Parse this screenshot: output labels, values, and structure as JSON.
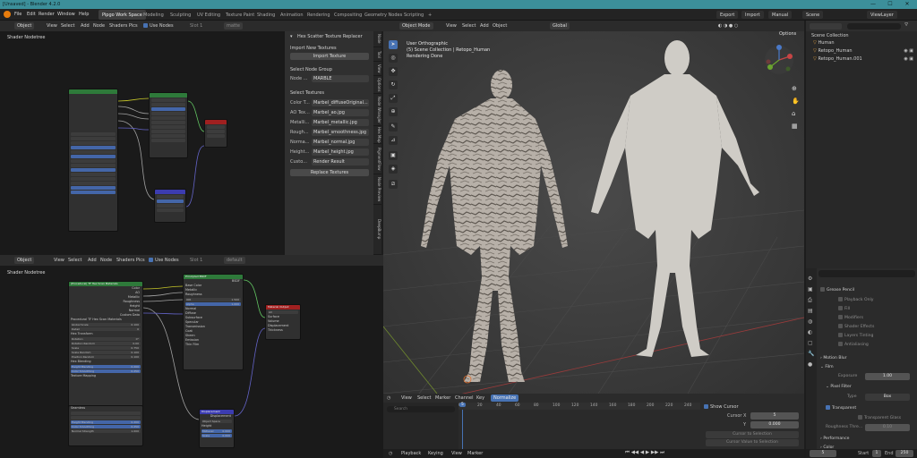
{
  "window": {
    "title": "[Unsaved] - Blender 4.2.0",
    "controls": [
      "—",
      "☐",
      "✕"
    ]
  },
  "menu": [
    "File",
    "Edit",
    "Render",
    "Window",
    "Help"
  ],
  "workspaces": [
    "Pipgo Work Space",
    "Modeling",
    "Sculpting",
    "UV Editing",
    "Texture Paint",
    "Shading",
    "Animation",
    "Rendering",
    "Compositing",
    "Geometry Nodes",
    "Scripting"
  ],
  "topright": {
    "export": "Export",
    "import": "Import",
    "manual": "Manual",
    "scene": "Scene",
    "viewlayer": "ViewLayer"
  },
  "node_editor_top": {
    "header": {
      "mode": "Object",
      "items": [
        "View",
        "Select",
        "Add",
        "Node",
        "Shaders Pics"
      ],
      "use_nodes": "Use Nodes",
      "slot": "Slot 1",
      "material": "matte"
    },
    "title": "Shader Nodetree"
  },
  "node_editor_bottom": {
    "header": {
      "mode": "Object",
      "items": [
        "View",
        "Select",
        "Add",
        "Node",
        "Shaders Pics"
      ],
      "use_nodes": "Use Nodes",
      "slot": "Slot 1",
      "material": "default"
    },
    "title": "Shader Nodetree",
    "nodes": {
      "hex_group": {
        "title": "(Procedural) TF Hex Scan Materials",
        "outputs": [
          "Color",
          "AO",
          "Metallic",
          "Roughness",
          "Height",
          "Normal",
          "Custom Data"
        ],
        "inner_title": "Procedural TF Hex Scan Materials",
        "fields": [
          [
            "Global Scale",
            "0.100"
          ],
          [
            "Detail",
            "0"
          ],
          [
            "Hex Transform",
            ""
          ],
          [
            "Rotation",
            "0°"
          ],
          [
            "Rotation Random",
            "0.00"
          ],
          [
            "Scale",
            "0.750"
          ],
          [
            "Scale Random",
            "0.100"
          ],
          [
            "Position Random",
            "0.100"
          ]
        ],
        "blending": "Hex Blending",
        "blend_fields": [
          [
            "Height Blending",
            "0.200"
          ],
          [
            "Color Smoothing",
            "0.250"
          ]
        ],
        "mapping": "Texture Mapping",
        "section2": "Seamless",
        "bottom_fields": [
          [
            "Height Blending",
            "0.200"
          ],
          [
            "Color Smoothing",
            "0.250"
          ],
          [
            "Normal Strength",
            "1.000"
          ]
        ]
      },
      "principled": {
        "title": "Principled BSDF",
        "out": "BSDF",
        "rows": [
          "Base Color",
          "Metallic",
          "Roughness",
          "IOR",
          "Alpha",
          "Normal",
          "Diffuse",
          "Subsurface",
          "Specular",
          "Transmission",
          "Coat",
          "Sheen",
          "Emission",
          "Thin Film"
        ],
        "vals": {
          "IOR": "1.500",
          "Alpha": "1.000"
        }
      },
      "output": {
        "title": "Material Output",
        "sel": "All",
        "rows": [
          "Surface",
          "Volume",
          "Displacement",
          "Thickness"
        ]
      },
      "displacement": {
        "title": "Displacement",
        "out": "Displacement",
        "rows": [
          "Object Space",
          "Height",
          "Midlevel",
          "Scale",
          "Normal"
        ],
        "vals": {
          "Midlevel": "0.000",
          "Scale": "0.000"
        }
      }
    }
  },
  "npanel": {
    "title": "Hex Scatter Texture Replacer",
    "import_section": "Import New Textures",
    "import_button": "Import Texture",
    "select_group": "Select Node Group",
    "node_label": "Node ...",
    "node_value": "MARBLE",
    "select_textures": "Select Textures",
    "rows": [
      [
        "Color T...",
        "Marbel_diffuseOriginal..."
      ],
      [
        "AO Tex...",
        "Marbel_ao.jpg"
      ],
      [
        "Metalli...",
        "Marbel_metallic.jpg"
      ],
      [
        "Rough...",
        "Marbel_smoothness.jpg"
      ],
      [
        "Norma...",
        "Marbel_normal.jpg"
      ],
      [
        "Height...",
        "Marbel_height.jpg"
      ],
      [
        "Custo...",
        "Render Result"
      ]
    ],
    "replace_button": "Replace Textures",
    "tabs": [
      "Node",
      "Tool",
      "View",
      "Options",
      "Node Wrangler",
      "Hex Map",
      "PigmentFlow",
      "Node Preview",
      "DeepBump"
    ]
  },
  "viewport": {
    "header": {
      "mode": "Object Mode",
      "items": [
        "View",
        "Select",
        "Add",
        "Object"
      ],
      "orientation": "Global"
    },
    "overlay_lines": [
      "User Orthographic",
      "(5) Scene Collection | Retopo_Human",
      "Rendering Done"
    ],
    "options": "Options",
    "colors": {
      "grid": "#555555",
      "xaxis": "#9a3b3b",
      "yaxis": "#6f8a2e"
    },
    "tools": [
      "arrow-cursor-icon",
      "circle-cursor-icon",
      "move-icon",
      "rotate-icon",
      "scale-icon",
      "transform-icon",
      "annotate-icon",
      "measure-icon",
      "add-cube-icon",
      "shear-icon",
      "transform-lines-icon"
    ]
  },
  "outliner": {
    "title": "Scene Collection",
    "items": [
      "Human",
      "Retopo_Human",
      "Retopo_Human.001"
    ]
  },
  "properties": {
    "items": [
      {
        "label": "Grease Pencil",
        "checked": false
      },
      {
        "label": "Playback Only",
        "checked": false,
        "sub": true
      },
      {
        "label": "Fill",
        "checked": true,
        "sub": true
      },
      {
        "label": "Modifiers",
        "checked": true,
        "sub": true
      },
      {
        "label": "Shader Effects",
        "checked": true,
        "sub": true
      },
      {
        "label": "Layers Tinting",
        "checked": true,
        "sub": true
      },
      {
        "label": "Antialiasing",
        "checked": true,
        "sub": true
      }
    ],
    "motion_blur": "Motion Blur",
    "film": "Film",
    "exposure_label": "Exposure",
    "exposure_value": "1.00",
    "pixel_filter": "Pixel Filter",
    "type_label": "Type",
    "type_value": "Box",
    "transparent": "Transparent",
    "transparent_glass": "Transparent Glass",
    "roughness_thresh": "Roughness Thre...",
    "roughness_val": "0.10",
    "performance": "Performance",
    "color": "Color",
    "frame_fields": {
      "current": "5",
      "start_label": "Start",
      "start": "1",
      "end_label": "End",
      "end": "250"
    }
  },
  "timeline": {
    "header": [
      "View",
      "Select",
      "Marker",
      "Channel",
      "Key"
    ],
    "normalize": "Normalize",
    "search": "Search",
    "ticks": [
      "0",
      "20",
      "40",
      "60",
      "80",
      "100",
      "120",
      "140",
      "160",
      "180",
      "200",
      "220",
      "240"
    ],
    "current": "5",
    "playback": [
      "Playback",
      "Keying",
      "View",
      "Marker"
    ],
    "cursor": "Show Cursor",
    "cursor_x_label": "Cursor X",
    "cursor_x": "5",
    "y_label": "Y",
    "y_value": "0.000",
    "cursor_to_selection": "Cursor to Selection",
    "cursor_value_to_selection": "Cursor Value to Selection"
  }
}
